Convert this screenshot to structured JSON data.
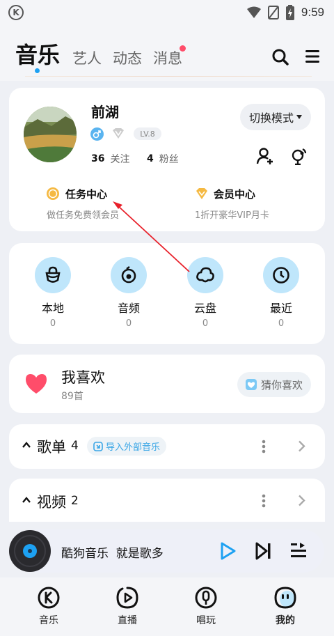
{
  "status_bar": {
    "time": "9:59",
    "app_logo": "K"
  },
  "header": {
    "tabs": [
      {
        "label": "音乐",
        "active": true
      },
      {
        "label": "艺人",
        "active": false
      },
      {
        "label": "动态",
        "active": false
      },
      {
        "label": "消息",
        "active": false,
        "badge": true
      }
    ],
    "icons": [
      "search-icon",
      "menu-icon"
    ]
  },
  "profile": {
    "name": "前湖",
    "level": "LV.8",
    "follow_count": "36",
    "follow_label": "关注",
    "fans_count": "4",
    "fans_label": "粉丝",
    "mode_button": "切换模式",
    "task_center": {
      "title": "任务中心",
      "subtitle": "做任务免费领会员"
    },
    "vip_center": {
      "title": "会员中心",
      "subtitle": "1折开豪华VIP月卡"
    }
  },
  "quick_grid": [
    {
      "label": "本地",
      "count": "0",
      "icon": "bag-icon"
    },
    {
      "label": "音频",
      "count": "0",
      "icon": "audio-icon"
    },
    {
      "label": "云盘",
      "count": "0",
      "icon": "cloud-icon"
    },
    {
      "label": "最近",
      "count": "0",
      "icon": "clock-icon"
    }
  ],
  "favorites": {
    "title": "我喜欢",
    "count": "89首",
    "guess_label": "猜你喜欢"
  },
  "playlists": {
    "title": "歌单",
    "count": "4",
    "import_label": "导入外部音乐"
  },
  "videos": {
    "title": "视频",
    "count": "2"
  },
  "player": {
    "text": "酷狗音乐  就是歌多"
  },
  "bottom_nav": [
    {
      "label": "音乐",
      "icon": "kugou-icon"
    },
    {
      "label": "直播",
      "icon": "live-icon"
    },
    {
      "label": "唱玩",
      "icon": "mic-icon"
    },
    {
      "label": "我的",
      "icon": "face-icon",
      "active": true
    }
  ],
  "colors": {
    "accent": "#1da1f2",
    "icon_bg": "#bfe6fb",
    "heart": "#ff4d6a",
    "annotation": "#e8202a"
  }
}
